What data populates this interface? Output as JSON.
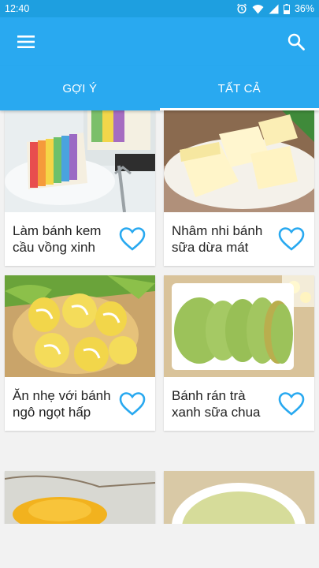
{
  "status_bar": {
    "time": "12:40",
    "battery": "36%"
  },
  "app_bar": {
    "menu_icon": "menu-icon",
    "search_icon": "search-icon"
  },
  "tabs": [
    {
      "label": "GỢI Ý",
      "active": false
    },
    {
      "label": "TẤT CẢ",
      "active": true
    }
  ],
  "recipes": [
    {
      "title": "Làm bánh kem cầu vồng xinh",
      "favorite_icon": "heart-outline-icon"
    },
    {
      "title": "Nhâm nhi bánh sữa dừa mát",
      "favorite_icon": "heart-outline-icon"
    },
    {
      "title": "Ăn nhẹ với bánh ngô ngọt hấp",
      "favorite_icon": "heart-outline-icon"
    },
    {
      "title": "Bánh rán trà xanh sữa chua",
      "favorite_icon": "heart-outline-icon"
    }
  ],
  "colors": {
    "primary": "#29a9f0",
    "status_bar": "#1e9fe0",
    "accent_heart": "#29a9f0",
    "background": "#f2f2f2"
  }
}
